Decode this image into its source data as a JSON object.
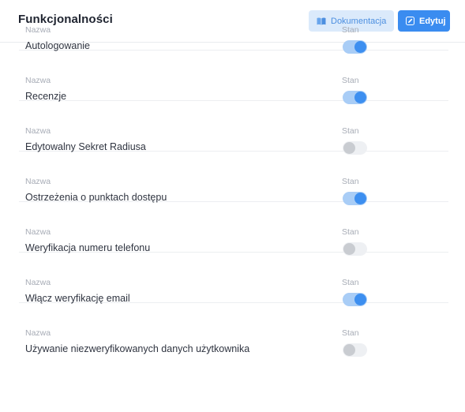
{
  "header": {
    "title": "Funkcjonalności",
    "docs_label": "Dokumentacja",
    "edit_label": "Edytuj"
  },
  "columns": {
    "name": "Nazwa",
    "state": "Stan"
  },
  "features": [
    {
      "name": "Autologowanie",
      "enabled": true
    },
    {
      "name": "Recenzje",
      "enabled": true
    },
    {
      "name": "Edytowalny Sekret Radiusa",
      "enabled": false
    },
    {
      "name": "Ostrzeżenia o punktach dostępu",
      "enabled": true
    },
    {
      "name": "Weryfikacja numeru telefonu",
      "enabled": false
    },
    {
      "name": "Włącz weryfikację email",
      "enabled": true
    },
    {
      "name": "Używanie niezweryfikowanych danych użytkownika",
      "enabled": false
    }
  ],
  "colors": {
    "accent": "#3a8cf0",
    "toggle_on_track": "#a9cdf6",
    "toggle_off_track": "#eef0f3"
  }
}
